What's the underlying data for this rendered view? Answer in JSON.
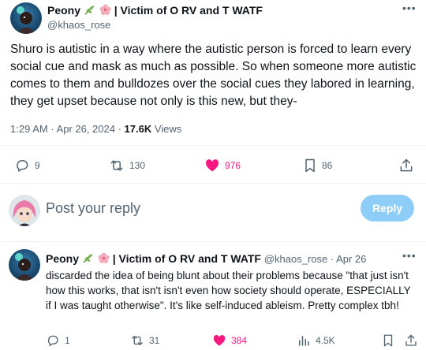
{
  "tweet": {
    "author_name": "Peony",
    "author_suffix": "| Victim of O RV and T WATF",
    "handle": "@khaos_rose",
    "text": "Shuro is autistic in a way where the autistic person is forced to learn every social cue and mask as much as possible. So when someone more autistic comes to them and bulldozes over the social cues they labored in learning, they get upset because not only is this new, but they-",
    "time": "1:29 AM · Apr 26, 2024 · ",
    "views_count": "17.6K",
    "views_label": " Views",
    "actions": {
      "replies": "9",
      "retweets": "130",
      "likes": "976",
      "bookmarks": "86"
    }
  },
  "composer": {
    "placeholder": "Post your reply",
    "button_label": "Reply"
  },
  "reply": {
    "author_name": "Peony",
    "author_suffix": "| Victim of O RV and T WATF",
    "handle_date": "@khaos_rose · Apr 26",
    "text": "discarded the idea of being blunt about their problems because \"that just isn't how this works, that isn't isn't even how society should operate, ESPECIALLY if I was taught otherwise\". It's like self-induced ableism. Pretty complex tbh!",
    "actions": {
      "replies": "1",
      "retweets": "31",
      "likes": "384",
      "views": "4.5K"
    }
  },
  "colors": {
    "like_active": "#f91880",
    "muted": "#536471",
    "reply_button": "#8ecdf7"
  }
}
